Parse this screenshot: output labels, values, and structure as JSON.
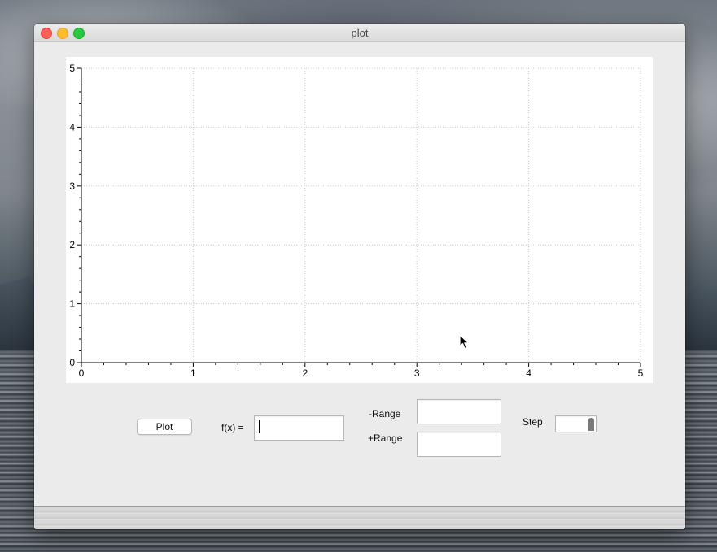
{
  "window": {
    "title": "plot"
  },
  "chart_data": {
    "type": "line",
    "title": "",
    "xlabel": "",
    "ylabel": "",
    "xlim": [
      0,
      5
    ],
    "ylim": [
      0,
      5
    ],
    "x_ticks": [
      "0",
      "1",
      "2",
      "3",
      "4",
      "5"
    ],
    "y_ticks": [
      "0",
      "1",
      "2",
      "3",
      "4",
      "5"
    ],
    "grid": true,
    "series": []
  },
  "controls": {
    "plot_button": "Plot",
    "fx_label": "f(x) =",
    "fx_value": "",
    "neg_range_label": "-Range",
    "neg_range_value": "",
    "pos_range_label": "+Range",
    "pos_range_value": "",
    "step_label": "Step",
    "step_value": ""
  },
  "icons": {
    "close": "close-icon",
    "minimize": "minimize-icon",
    "maximize": "maximize-icon",
    "cursor": "arrow-cursor-icon"
  },
  "colors": {
    "close": "#fc5f57",
    "minimize": "#fdbc2e",
    "maximize": "#28c840"
  }
}
